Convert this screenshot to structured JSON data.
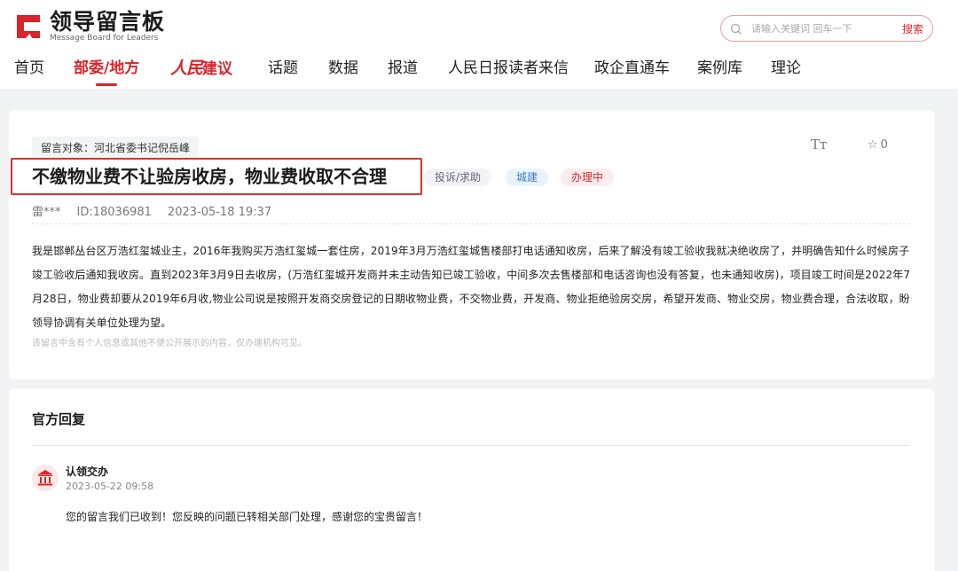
{
  "brand": {
    "name": "领导留言板",
    "subtitle": "Message Board for Leaders",
    "accent_color": "#d6262c"
  },
  "search": {
    "placeholder": "请输入关键词 回车一下",
    "button_label": "搜索"
  },
  "nav": {
    "items": [
      {
        "label": "首页"
      },
      {
        "label": "部委/地方",
        "active": true
      },
      {
        "label_script": "人民",
        "label": "建议"
      },
      {
        "label": "话题"
      },
      {
        "label": "数据"
      },
      {
        "label": "报道"
      },
      {
        "label": "人民日报读者来信"
      },
      {
        "label": "政企直通车"
      },
      {
        "label": "案例库"
      },
      {
        "label": "理论"
      }
    ]
  },
  "message": {
    "target": "留言对象：河北省委书记倪岳峰",
    "font_size_icon_label": "Tт",
    "favorite_icon": "☆",
    "favorite_count": "0",
    "title": "不缴物业费不让验房收房，物业费收取不合理",
    "tags": {
      "type": "投诉/求助",
      "field": "城建",
      "status": "办理中"
    },
    "author": "雷***",
    "id": "ID:18036981",
    "datetime": "2023-05-18 19:37",
    "body": "我是邯郸丛台区万浩红玺城业主，2016年我购买万浩红玺城一套住房，2019年3月万浩红玺城售楼部打电话通知收房，后来了解没有竣工验收我就决绝收房了，并明确告知什么时候房子竣工验收后通知我收房。直到2023年3月9日去收房，(万浩红玺城开发商并未主动告知已竣工验收，中间多次去售楼部和电话咨询也没有答复，也未通知收房)，项目竣工时间是2022年7月28日，物业费却要从2019年6月收,物业公司说是按照开发商交房登记的日期收物业费，不交物业费，开发商、物业拒绝验房交房，希望开发商、物业交房，物业费合理，合法收取，盼领导协调有关单位处理为望。",
    "privacy_note": "该留言中含有个人信息或其他不便公开展示的内容，仅办理机构可见。"
  },
  "reply": {
    "heading": "官方回复",
    "org": "认领交办",
    "datetime": "2023-05-22 09:58",
    "body": "您的留言我们已收到！您反映的问题已转相关部门处理，感谢您的宝贵留言！"
  }
}
